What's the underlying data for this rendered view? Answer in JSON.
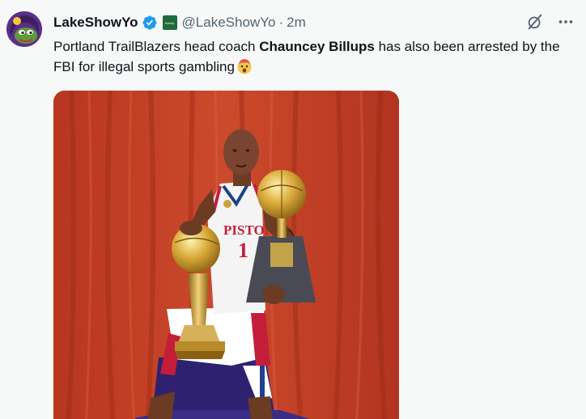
{
  "tweet": {
    "display_name": "LakeShowYo",
    "affiliate_badge_text": "Kandy",
    "handle": "@LakeShowYo",
    "separator": "·",
    "timestamp": "2m",
    "text_before": "Portland TrailBlazers head coach ",
    "text_bold": "Chauncey Billups",
    "text_after": " has also been arrested by the FBI for illegal sports gambling",
    "emoji": "exploding-head-emoji"
  },
  "media": {
    "jersey_word": "PISTONS",
    "jersey_number": "1"
  },
  "icons": {
    "verified": "verified-badge-icon",
    "grok": "grok-icon",
    "more": "more-options-icon"
  },
  "colors": {
    "verified_blue": "#1d9bf0",
    "text_primary": "#0f1419",
    "text_secondary": "#536471",
    "background": "#f7f9f9",
    "curtain_red": "#c23f2a"
  }
}
